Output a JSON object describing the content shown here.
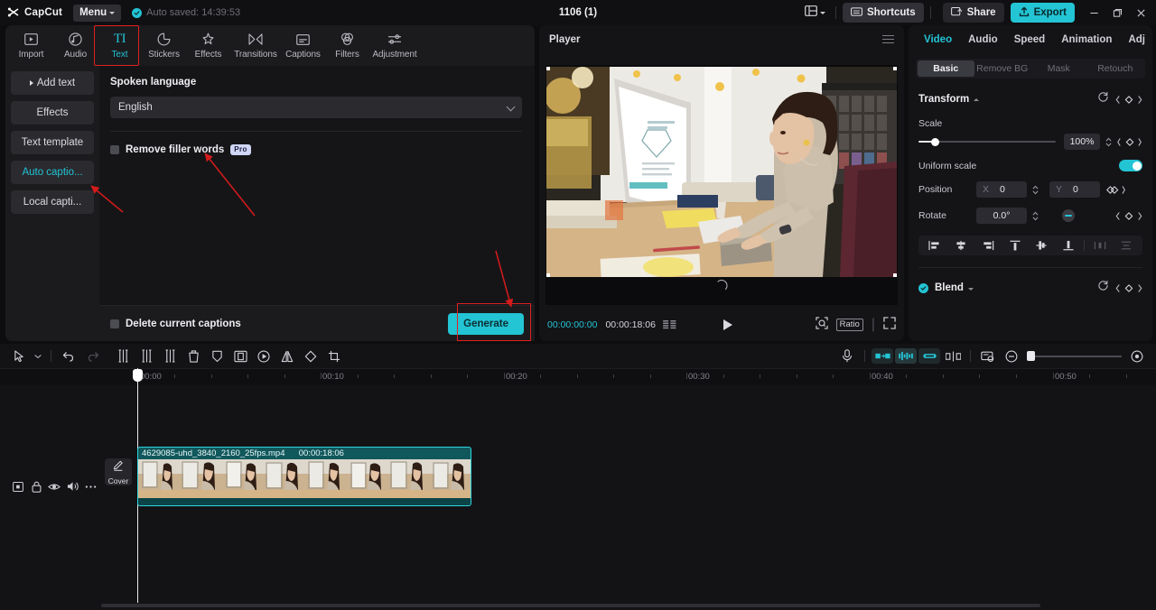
{
  "titlebar": {
    "app_name": "CapCut",
    "menu_label": "Menu",
    "autosave": "Auto saved: 14:39:53",
    "project_title": "1106 (1)",
    "shortcuts_label": "Shortcuts",
    "share_label": "Share",
    "export_label": "Export",
    "icons": {
      "layout": "layout-icon",
      "minimize": "minimize-icon",
      "restore": "restore-icon",
      "close": "close-icon"
    }
  },
  "toolbar": {
    "items": [
      {
        "label": "Import",
        "icon": "import-icon",
        "active": false
      },
      {
        "label": "Audio",
        "icon": "audio-icon",
        "active": false
      },
      {
        "label": "Text",
        "icon": "text-icon",
        "active": true
      },
      {
        "label": "Stickers",
        "icon": "stickers-icon",
        "active": false
      },
      {
        "label": "Effects",
        "icon": "effects-icon",
        "active": false
      },
      {
        "label": "Transitions",
        "icon": "transitions-icon",
        "active": false
      },
      {
        "label": "Captions",
        "icon": "captions-icon",
        "active": false
      },
      {
        "label": "Filters",
        "icon": "filters-icon",
        "active": false
      },
      {
        "label": "Adjustment",
        "icon": "adjustment-icon",
        "active": false
      }
    ]
  },
  "sidebar": {
    "items": [
      {
        "label": "Add text",
        "active": false,
        "has_arrow": true
      },
      {
        "label": "Effects",
        "active": false,
        "has_arrow": false
      },
      {
        "label": "Text template",
        "active": false,
        "has_arrow": false
      },
      {
        "label": "Auto captio...",
        "active": true,
        "has_arrow": false
      },
      {
        "label": "Local capti...",
        "active": false,
        "has_arrow": false
      }
    ]
  },
  "captions_panel": {
    "spoken_language_label": "Spoken language",
    "language_value": "English",
    "remove_filler_label": "Remove filler words",
    "pro_badge": "Pro",
    "remove_filler_checked": false,
    "delete_captions_label": "Delete current captions",
    "delete_captions_checked": false,
    "generate_label": "Generate"
  },
  "player": {
    "title": "Player",
    "current_time": "00:00:00:00",
    "total_time": "00:00:18:06",
    "ratio_label": "Ratio",
    "icons": {
      "menu": "hamburger-icon",
      "frames": "frames-icon",
      "play": "play-icon",
      "snapshot": "snapshot-icon",
      "fullscreen": "fullscreen-icon"
    }
  },
  "right_panel": {
    "tabs": [
      {
        "label": "Video",
        "active": true
      },
      {
        "label": "Audio",
        "active": false
      },
      {
        "label": "Speed",
        "active": false
      },
      {
        "label": "Animation",
        "active": false
      },
      {
        "label": "Adju",
        "active": false
      }
    ],
    "subtabs": [
      {
        "label": "Basic",
        "active": true
      },
      {
        "label": "Remove BG",
        "active": false
      },
      {
        "label": "Mask",
        "active": false
      },
      {
        "label": "Retouch",
        "active": false
      }
    ],
    "transform": {
      "title": "Transform",
      "scale_label": "Scale",
      "scale_value": "100%",
      "uniform_scale_label": "Uniform scale",
      "uniform_scale_on": true,
      "position_label": "Position",
      "position_x_axis": "X",
      "position_x": "0",
      "position_y_axis": "Y",
      "position_y": "0",
      "rotate_label": "Rotate",
      "rotate_value": "0.0°"
    },
    "alignment_icons": [
      "align-left-icon",
      "align-center-horizontal-icon",
      "align-right-icon",
      "align-top-icon",
      "align-center-vertical-icon",
      "align-bottom-icon",
      "distribute-horizontal-icon",
      "distribute-vertical-icon"
    ],
    "blend": {
      "title": "Blend",
      "enabled": true
    }
  },
  "timeline": {
    "tools": [
      "select-icon",
      "undo-icon",
      "redo-icon",
      "split-icon",
      "trim-left-icon",
      "trim-right-icon",
      "delete-icon",
      "marker-icon",
      "freeze-icon",
      "speed-icon",
      "mirror-icon",
      "rotate-icon",
      "crop-icon"
    ],
    "right_tools": [
      "microphone-icon",
      "auto-cut-icon",
      "keyframe-icon",
      "link-icon",
      "split-track-icon",
      "preview-icon",
      "zoom-out-icon",
      "zoom-in-icon"
    ],
    "ruler_labels": [
      "00:00",
      "00:10",
      "00:20",
      "00:30",
      "00:40",
      "00:50"
    ],
    "track_icons": [
      "track-type-icon",
      "lock-icon",
      "eye-icon",
      "volume-icon",
      "more-icon"
    ],
    "cover_label": "Cover",
    "clip": {
      "filename": "4629085-uhd_3840_2160_25fps.mp4",
      "duration": "00:00:18:06"
    }
  },
  "colors": {
    "accent": "#23c4d4",
    "annotation_red": "#e02020",
    "clip_teal": "#11585c",
    "panel_bg": "#141417",
    "app_bg": "#0d0d0f"
  }
}
